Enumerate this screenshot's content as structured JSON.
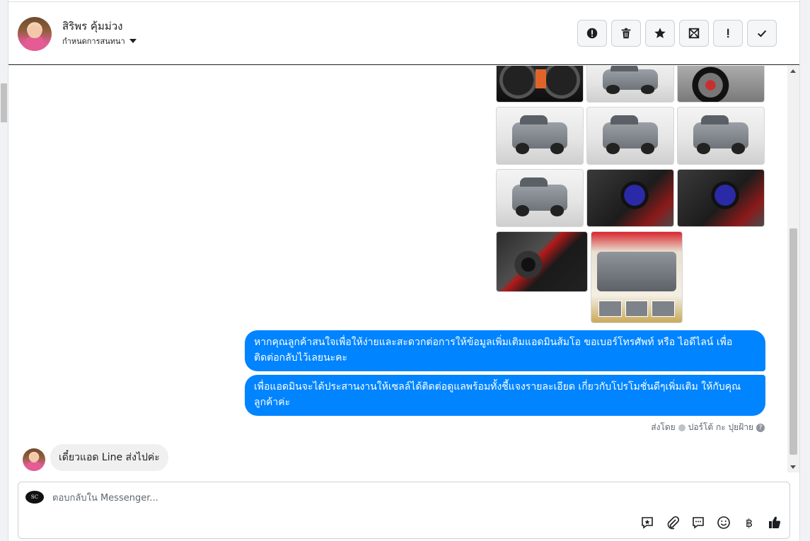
{
  "header": {
    "contact_name": "สิริพร คุ้มม่วง",
    "assign_label": "กำหนดการสนทนา",
    "toolbar": [
      {
        "name": "spam-button",
        "icon": "alert-circle-icon"
      },
      {
        "name": "delete-button",
        "icon": "trash-icon"
      },
      {
        "name": "star-button",
        "icon": "star-icon"
      },
      {
        "name": "mark-unread-button",
        "icon": "mail-icon"
      },
      {
        "name": "important-button",
        "icon": "exclamation-icon"
      },
      {
        "name": "done-button",
        "icon": "check-icon"
      }
    ]
  },
  "messages": {
    "outgoing": [
      "หากคุณลูกค้าสนใจเพื่อให้ง่ายและสะดวกต่อการให้ข้อมูลเพิ่มเติมแอดมินส้มโอ ขอเบอร์โทรศัพท์ หรือ ไอดีไลน์ เพื่อติดต่อกลับไว้เลยนะคะ",
      "เพื่อแอดมินจะได้ประสานงานให้เซลล์ได้ติดต่อดูแลพร้อมทั้งชี้แจงรายละเอียด เกี่ยวกับโปรโมชั่นดีๆเพิ่มเติม ให้กับคุณลูกค้าค่ะ"
    ],
    "sent_by_prefix": "ส่งโดย",
    "sent_by_name": "ปอร์โต้ กะ ปุยฝ้าย",
    "incoming": "เดี๋ยวแอด Line ส่งไปค่ะ"
  },
  "composer": {
    "placeholder": "ตอบกลับใน Messenger...",
    "page_logo_text": "SC",
    "baht_symbol": "฿",
    "tools": [
      "saved-reply-icon",
      "attachment-icon",
      "chat-bubble-icon",
      "emoji-icon",
      "baht-icon",
      "like-icon"
    ]
  },
  "colors": {
    "outgoing_bubble": "#0084ff",
    "incoming_bubble": "#f1f0f0"
  }
}
